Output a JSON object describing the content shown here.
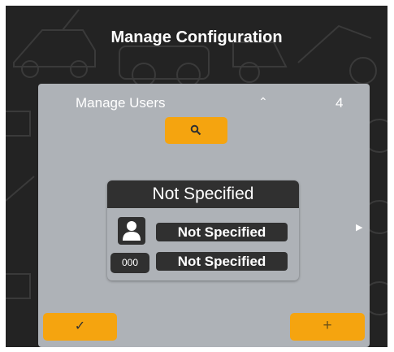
{
  "header": {
    "title": "Manage Configuration"
  },
  "users_panel": {
    "label": "Manage Users",
    "collapse_icon": "chevron-up-icon",
    "count": "4",
    "search_icon": "search-icon"
  },
  "user_card": {
    "header": "Not Specified",
    "avatar_icon": "person-icon",
    "id_badge": "000",
    "field1": "Not Specified",
    "field2": "Not Specified",
    "next_icon": "chevron-right-icon"
  },
  "actions": {
    "confirm_label": "✓",
    "add_label": "+"
  },
  "colors": {
    "background": "#232323",
    "panel": "#aeb2b7",
    "accent": "#f5a40f",
    "dark": "#303030"
  }
}
